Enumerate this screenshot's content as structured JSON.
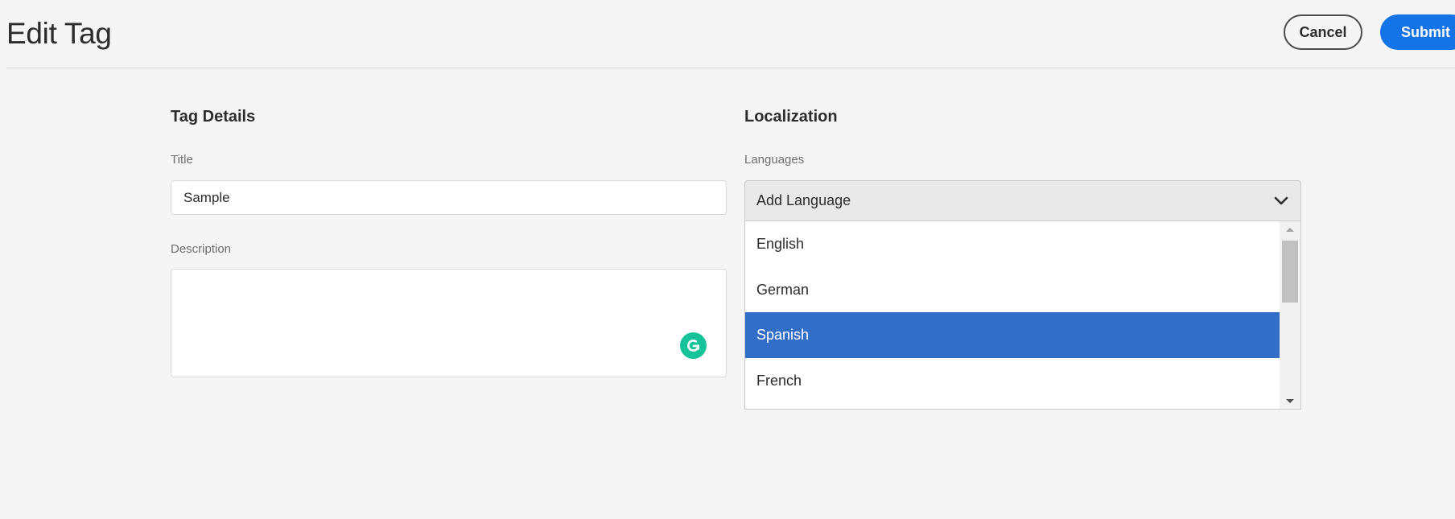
{
  "header": {
    "title": "Edit Tag",
    "cancel_label": "Cancel",
    "submit_label": "Submit"
  },
  "tag_details": {
    "heading": "Tag Details",
    "title_label": "Title",
    "title_value": "Sample",
    "description_label": "Description",
    "description_value": ""
  },
  "localization": {
    "heading": "Localization",
    "languages_label": "Languages",
    "select_placeholder": "Add Language",
    "options": [
      "English",
      "German",
      "Spanish",
      "French"
    ],
    "selected_option": "Spanish"
  },
  "colors": {
    "accent": "#1473e6",
    "selected_option_bg": "#326ec8",
    "grammarly": "#15c39a"
  },
  "icons": {
    "dropdown": "chevron-down-icon",
    "grammarly": "grammarly-icon",
    "scroll_up": "scroll-up-arrow-icon",
    "scroll_down": "scroll-down-arrow-icon"
  }
}
